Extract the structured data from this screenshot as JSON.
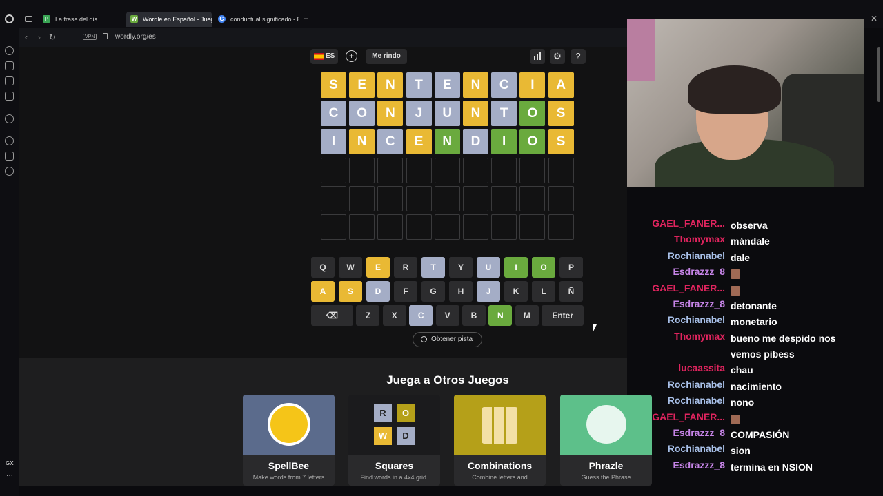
{
  "browser": {
    "tabs": [
      {
        "label": "La frase del dia",
        "fav": "P",
        "color": "#3aa655"
      },
      {
        "label": "Wordle en Español - Jueg",
        "fav": "W",
        "color": "#6aaa3e"
      },
      {
        "label": "conductual significado - B",
        "fav": "G",
        "color": "#4285f4"
      }
    ],
    "new_tab": "+",
    "vpn": "VPN",
    "url": "wordly.org/es",
    "gx": "GX"
  },
  "toolbar": {
    "lang": "ES",
    "give_up": "Me rindo",
    "add": "+",
    "stats_icon": "bar-chart-icon",
    "settings_icon": "gear-icon",
    "help_icon": "help-icon"
  },
  "board": {
    "rows": [
      {
        "letters": [
          "S",
          "E",
          "N",
          "T",
          "E",
          "N",
          "C",
          "I",
          "A"
        ],
        "states": [
          "y",
          "y",
          "y",
          "x",
          "x",
          "y",
          "x",
          "y",
          "y"
        ]
      },
      {
        "letters": [
          "C",
          "O",
          "N",
          "J",
          "U",
          "N",
          "T",
          "O",
          "S"
        ],
        "states": [
          "x",
          "x",
          "y",
          "x",
          "x",
          "y",
          "x",
          "g",
          "y"
        ]
      },
      {
        "letters": [
          "I",
          "N",
          "C",
          "E",
          "N",
          "D",
          "I",
          "O",
          "S"
        ],
        "states": [
          "x",
          "y",
          "x",
          "y",
          "g",
          "x",
          "g",
          "g",
          "y"
        ]
      },
      {
        "letters": [
          "",
          "",
          "",
          "",
          "",
          "",
          "",
          "",
          ""
        ],
        "states": [
          "e",
          "e",
          "e",
          "e",
          "e",
          "e",
          "e",
          "e",
          "e"
        ]
      },
      {
        "letters": [
          "",
          "",
          "",
          "",
          "",
          "",
          "",
          "",
          ""
        ],
        "states": [
          "e",
          "e",
          "e",
          "e",
          "e",
          "e",
          "e",
          "e",
          "e"
        ]
      },
      {
        "letters": [
          "",
          "",
          "",
          "",
          "",
          "",
          "",
          "",
          ""
        ],
        "states": [
          "e",
          "e",
          "e",
          "e",
          "e",
          "e",
          "e",
          "e",
          "e"
        ]
      }
    ]
  },
  "keyboard": {
    "rows": [
      [
        {
          "k": "Q",
          "s": ""
        },
        {
          "k": "W",
          "s": ""
        },
        {
          "k": "E",
          "s": "y"
        },
        {
          "k": "R",
          "s": ""
        },
        {
          "k": "T",
          "s": "x"
        },
        {
          "k": "Y",
          "s": ""
        },
        {
          "k": "U",
          "s": "x"
        },
        {
          "k": "I",
          "s": "g"
        },
        {
          "k": "O",
          "s": "g"
        },
        {
          "k": "P",
          "s": ""
        }
      ],
      [
        {
          "k": "A",
          "s": "y"
        },
        {
          "k": "S",
          "s": "y"
        },
        {
          "k": "D",
          "s": "x"
        },
        {
          "k": "F",
          "s": ""
        },
        {
          "k": "G",
          "s": ""
        },
        {
          "k": "H",
          "s": ""
        },
        {
          "k": "J",
          "s": "x"
        },
        {
          "k": "K",
          "s": ""
        },
        {
          "k": "L",
          "s": ""
        },
        {
          "k": "Ñ",
          "s": ""
        }
      ],
      [
        {
          "k": "⌫",
          "s": "",
          "w": "wide"
        },
        {
          "k": "Z",
          "s": ""
        },
        {
          "k": "X",
          "s": ""
        },
        {
          "k": "C",
          "s": "x"
        },
        {
          "k": "V",
          "s": ""
        },
        {
          "k": "B",
          "s": ""
        },
        {
          "k": "N",
          "s": "g"
        },
        {
          "k": "M",
          "s": ""
        },
        {
          "k": "Enter",
          "s": "",
          "w": "wide"
        }
      ]
    ],
    "hint": "Obtener pista"
  },
  "others": {
    "title": "Juega a Otros Juegos",
    "cards": [
      {
        "name": "SpellBee",
        "desc": "Make words from 7 letters",
        "bg": "#5b6b8c",
        "icon": "bee-icon"
      },
      {
        "name": "Squares",
        "desc": "Find words in a 4x4 grid.",
        "bg": "#1b1b1d",
        "icon": "squares-icon"
      },
      {
        "name": "Combinations",
        "desc": "Combine letters and",
        "bg": "#b5a019",
        "icon": "grid-icon"
      },
      {
        "name": "Phrazle",
        "desc": "Guess the Phrase",
        "bg": "#5dc08a",
        "icon": "chat-bubble-icon"
      }
    ]
  },
  "chat": [
    {
      "user": "GAEL_FANER...",
      "color": "#e0245e",
      "text": "observa"
    },
    {
      "user": "Thomymax",
      "color": "#e0245e",
      "text": "mándale"
    },
    {
      "user": "Rochianabel",
      "color": "#a8c0e8",
      "text": "dale"
    },
    {
      "user": "Esdrazzz_8",
      "color": "#c785e8",
      "text": ""
    },
    {
      "user": "GAEL_FANER...",
      "color": "#e0245e",
      "text": ""
    },
    {
      "user": "Esdrazzz_8",
      "color": "#c785e8",
      "text": "detonante"
    },
    {
      "user": "Rochianabel",
      "color": "#a8c0e8",
      "text": "monetario"
    },
    {
      "user": "Thomymax",
      "color": "#e0245e",
      "text": "bueno me despido nos vemos pibess"
    },
    {
      "user": "lucaassita",
      "color": "#e0245e",
      "text": "chau"
    },
    {
      "user": "Rochianabel",
      "color": "#a8c0e8",
      "text": "nacimiento"
    },
    {
      "user": "Rochianabel",
      "color": "#a8c0e8",
      "text": "nono"
    },
    {
      "user": "GAEL_FANER...",
      "color": "#e0245e",
      "text": ""
    },
    {
      "user": "Esdrazzz_8",
      "color": "#c785e8",
      "text": "COMPASIÓN"
    },
    {
      "user": "Rochianabel",
      "color": "#a8c0e8",
      "text": "sion"
    },
    {
      "user": "Esdrazzz_8",
      "color": "#c785e8",
      "text": "termina en NSION"
    }
  ]
}
